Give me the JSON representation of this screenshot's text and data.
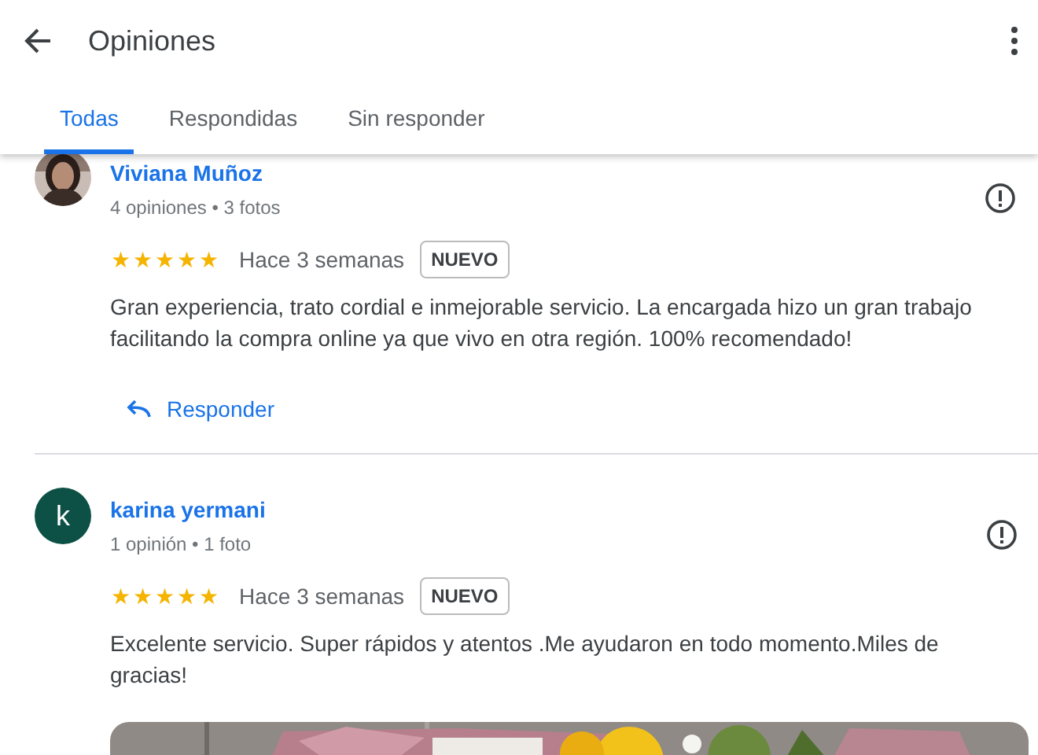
{
  "header": {
    "title": "Opiniones"
  },
  "tabs": [
    {
      "label": "Todas",
      "selected": true
    },
    {
      "label": "Respondidas",
      "selected": false
    },
    {
      "label": "Sin responder",
      "selected": false
    }
  ],
  "reviews": [
    {
      "name": "Viviana Muñoz",
      "meta": "4 opiniones • 3 fotos",
      "stars": 5,
      "time": "Hace 3 semanas",
      "badge": "NUEVO",
      "text": "Gran experiencia, trato cordial e inmejorable servicio. La encargada hizo un gran trabajo facilitando la compra online ya que vivo en otra región. 100% recomendado!",
      "reply": "Responder"
    },
    {
      "name": "karina yermani",
      "avatar": {
        "kind": "letter",
        "letter": "k",
        "color": "#0d5045"
      },
      "meta": "1 opinión • 1 foto",
      "stars": 5,
      "time": "Hace 3 semanas",
      "badge": "NUEVO",
      "text": "Excelente servicio. Super rápidos y atentos .Me ayudaron en todo momento.Miles de gracias!"
    }
  ]
}
